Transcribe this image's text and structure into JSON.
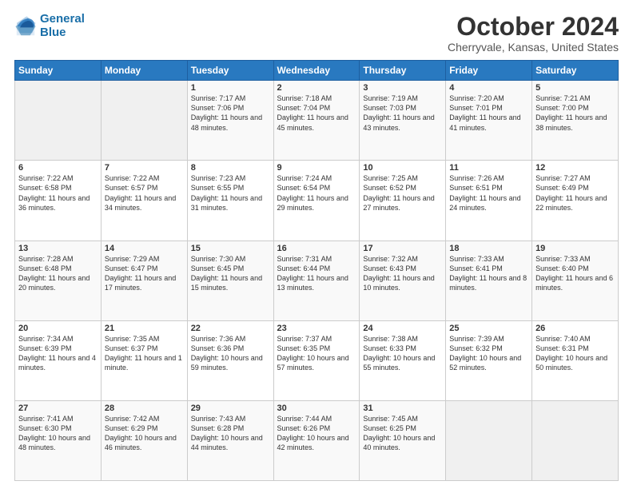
{
  "logo": {
    "line1": "General",
    "line2": "Blue"
  },
  "title": "October 2024",
  "subtitle": "Cherryvale, Kansas, United States",
  "days_of_week": [
    "Sunday",
    "Monday",
    "Tuesday",
    "Wednesday",
    "Thursday",
    "Friday",
    "Saturday"
  ],
  "weeks": [
    [
      {
        "day": "",
        "empty": true
      },
      {
        "day": "",
        "empty": true
      },
      {
        "day": "1",
        "sunrise": "Sunrise: 7:17 AM",
        "sunset": "Sunset: 7:06 PM",
        "daylight": "Daylight: 11 hours and 48 minutes."
      },
      {
        "day": "2",
        "sunrise": "Sunrise: 7:18 AM",
        "sunset": "Sunset: 7:04 PM",
        "daylight": "Daylight: 11 hours and 45 minutes."
      },
      {
        "day": "3",
        "sunrise": "Sunrise: 7:19 AM",
        "sunset": "Sunset: 7:03 PM",
        "daylight": "Daylight: 11 hours and 43 minutes."
      },
      {
        "day": "4",
        "sunrise": "Sunrise: 7:20 AM",
        "sunset": "Sunset: 7:01 PM",
        "daylight": "Daylight: 11 hours and 41 minutes."
      },
      {
        "day": "5",
        "sunrise": "Sunrise: 7:21 AM",
        "sunset": "Sunset: 7:00 PM",
        "daylight": "Daylight: 11 hours and 38 minutes."
      }
    ],
    [
      {
        "day": "6",
        "sunrise": "Sunrise: 7:22 AM",
        "sunset": "Sunset: 6:58 PM",
        "daylight": "Daylight: 11 hours and 36 minutes."
      },
      {
        "day": "7",
        "sunrise": "Sunrise: 7:22 AM",
        "sunset": "Sunset: 6:57 PM",
        "daylight": "Daylight: 11 hours and 34 minutes."
      },
      {
        "day": "8",
        "sunrise": "Sunrise: 7:23 AM",
        "sunset": "Sunset: 6:55 PM",
        "daylight": "Daylight: 11 hours and 31 minutes."
      },
      {
        "day": "9",
        "sunrise": "Sunrise: 7:24 AM",
        "sunset": "Sunset: 6:54 PM",
        "daylight": "Daylight: 11 hours and 29 minutes."
      },
      {
        "day": "10",
        "sunrise": "Sunrise: 7:25 AM",
        "sunset": "Sunset: 6:52 PM",
        "daylight": "Daylight: 11 hours and 27 minutes."
      },
      {
        "day": "11",
        "sunrise": "Sunrise: 7:26 AM",
        "sunset": "Sunset: 6:51 PM",
        "daylight": "Daylight: 11 hours and 24 minutes."
      },
      {
        "day": "12",
        "sunrise": "Sunrise: 7:27 AM",
        "sunset": "Sunset: 6:49 PM",
        "daylight": "Daylight: 11 hours and 22 minutes."
      }
    ],
    [
      {
        "day": "13",
        "sunrise": "Sunrise: 7:28 AM",
        "sunset": "Sunset: 6:48 PM",
        "daylight": "Daylight: 11 hours and 20 minutes."
      },
      {
        "day": "14",
        "sunrise": "Sunrise: 7:29 AM",
        "sunset": "Sunset: 6:47 PM",
        "daylight": "Daylight: 11 hours and 17 minutes."
      },
      {
        "day": "15",
        "sunrise": "Sunrise: 7:30 AM",
        "sunset": "Sunset: 6:45 PM",
        "daylight": "Daylight: 11 hours and 15 minutes."
      },
      {
        "day": "16",
        "sunrise": "Sunrise: 7:31 AM",
        "sunset": "Sunset: 6:44 PM",
        "daylight": "Daylight: 11 hours and 13 minutes."
      },
      {
        "day": "17",
        "sunrise": "Sunrise: 7:32 AM",
        "sunset": "Sunset: 6:43 PM",
        "daylight": "Daylight: 11 hours and 10 minutes."
      },
      {
        "day": "18",
        "sunrise": "Sunrise: 7:33 AM",
        "sunset": "Sunset: 6:41 PM",
        "daylight": "Daylight: 11 hours and 8 minutes."
      },
      {
        "day": "19",
        "sunrise": "Sunrise: 7:33 AM",
        "sunset": "Sunset: 6:40 PM",
        "daylight": "Daylight: 11 hours and 6 minutes."
      }
    ],
    [
      {
        "day": "20",
        "sunrise": "Sunrise: 7:34 AM",
        "sunset": "Sunset: 6:39 PM",
        "daylight": "Daylight: 11 hours and 4 minutes."
      },
      {
        "day": "21",
        "sunrise": "Sunrise: 7:35 AM",
        "sunset": "Sunset: 6:37 PM",
        "daylight": "Daylight: 11 hours and 1 minute."
      },
      {
        "day": "22",
        "sunrise": "Sunrise: 7:36 AM",
        "sunset": "Sunset: 6:36 PM",
        "daylight": "Daylight: 10 hours and 59 minutes."
      },
      {
        "day": "23",
        "sunrise": "Sunrise: 7:37 AM",
        "sunset": "Sunset: 6:35 PM",
        "daylight": "Daylight: 10 hours and 57 minutes."
      },
      {
        "day": "24",
        "sunrise": "Sunrise: 7:38 AM",
        "sunset": "Sunset: 6:33 PM",
        "daylight": "Daylight: 10 hours and 55 minutes."
      },
      {
        "day": "25",
        "sunrise": "Sunrise: 7:39 AM",
        "sunset": "Sunset: 6:32 PM",
        "daylight": "Daylight: 10 hours and 52 minutes."
      },
      {
        "day": "26",
        "sunrise": "Sunrise: 7:40 AM",
        "sunset": "Sunset: 6:31 PM",
        "daylight": "Daylight: 10 hours and 50 minutes."
      }
    ],
    [
      {
        "day": "27",
        "sunrise": "Sunrise: 7:41 AM",
        "sunset": "Sunset: 6:30 PM",
        "daylight": "Daylight: 10 hours and 48 minutes."
      },
      {
        "day": "28",
        "sunrise": "Sunrise: 7:42 AM",
        "sunset": "Sunset: 6:29 PM",
        "daylight": "Daylight: 10 hours and 46 minutes."
      },
      {
        "day": "29",
        "sunrise": "Sunrise: 7:43 AM",
        "sunset": "Sunset: 6:28 PM",
        "daylight": "Daylight: 10 hours and 44 minutes."
      },
      {
        "day": "30",
        "sunrise": "Sunrise: 7:44 AM",
        "sunset": "Sunset: 6:26 PM",
        "daylight": "Daylight: 10 hours and 42 minutes."
      },
      {
        "day": "31",
        "sunrise": "Sunrise: 7:45 AM",
        "sunset": "Sunset: 6:25 PM",
        "daylight": "Daylight: 10 hours and 40 minutes."
      },
      {
        "day": "",
        "empty": true
      },
      {
        "day": "",
        "empty": true
      }
    ]
  ]
}
